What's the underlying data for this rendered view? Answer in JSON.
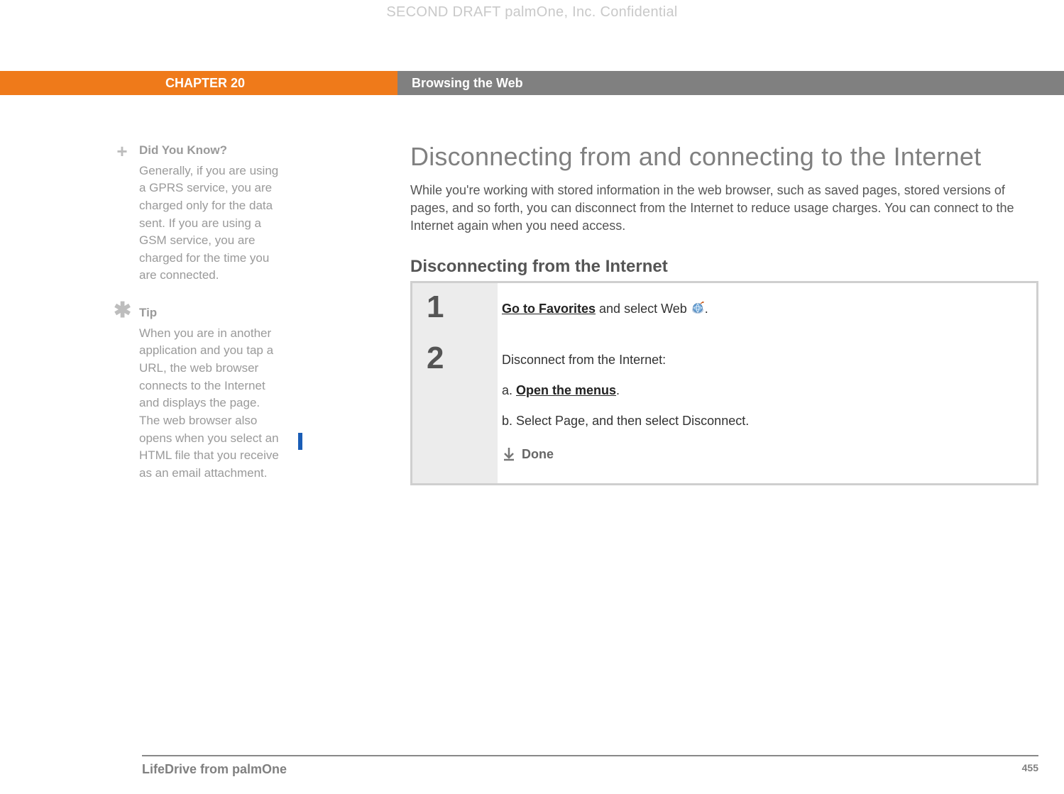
{
  "watermark": "SECOND DRAFT palmOne, Inc.  Confidential",
  "chapter": {
    "label": "CHAPTER 20",
    "title": "Browsing the Web"
  },
  "sidebar": {
    "didyouknow": {
      "title": "Did You Know?",
      "body": "Generally, if you are using a GPRS service, you are charged only for the data sent. If you are using a GSM service, you are charged for the time you are connected."
    },
    "tip": {
      "title": "Tip",
      "body": "When you are in another application and you tap a URL, the web browser connects to the Internet and displays the page. The web browser also opens when you select an HTML file that you receive as an email attachment."
    }
  },
  "main": {
    "heading": "Disconnecting from and connecting to the Internet",
    "intro": "While you're working with stored information in the web browser, such as saved pages, stored versions of pages, and so forth, you can disconnect from the Internet to reduce usage charges. You can connect to the Internet again when you need access.",
    "subheading": "Disconnecting from the Internet",
    "steps": {
      "s1": {
        "num": "1",
        "link": "Go to Favorites",
        "rest_a": " and select Web ",
        "rest_b": "."
      },
      "s2": {
        "num": "2",
        "lead": "Disconnect from the Internet:",
        "a_label": "a.  ",
        "a_link": "Open the menus",
        "a_tail": ".",
        "b": "b.  Select Page, and then select Disconnect.",
        "done": "Done"
      }
    }
  },
  "footer": {
    "product": "LifeDrive from palmOne",
    "page": "455"
  }
}
